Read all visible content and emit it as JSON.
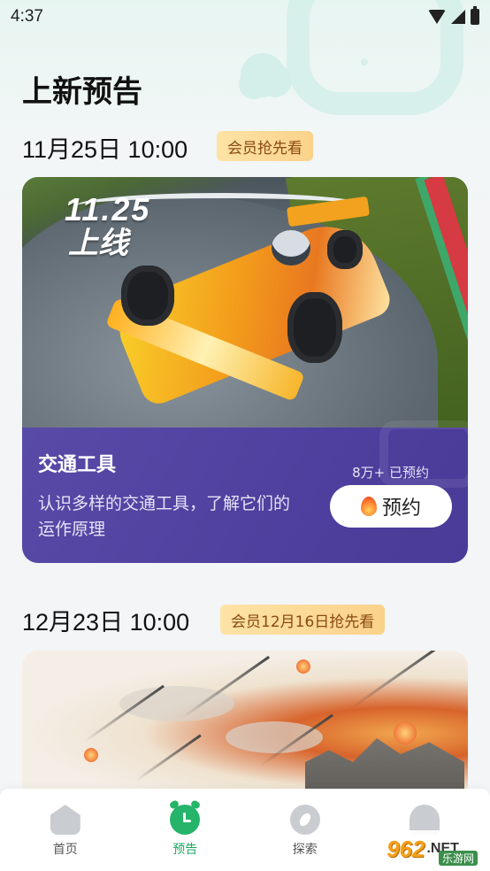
{
  "status_bar": {
    "time": "4:37"
  },
  "page": {
    "title": "上新预告"
  },
  "sections": [
    {
      "date": "11月25日 10:00",
      "member_tag": "会员抢先看",
      "card": {
        "image_text": {
          "date": "11.25",
          "sub": "上线"
        },
        "title": "交通工具",
        "description": "认识多样的交通工具，了解它们的运作原理",
        "reserve_count": "8万+ 已预约",
        "reserve_button": "预约"
      }
    },
    {
      "date": "12月23日 10:00",
      "member_tag": "会员12月16日抢先看"
    }
  ],
  "tab_bar": {
    "items": [
      {
        "label": "首页",
        "icon": "home-icon",
        "active": false
      },
      {
        "label": "预告",
        "icon": "alarm-clock-icon",
        "active": true
      },
      {
        "label": "探索",
        "icon": "compass-icon",
        "active": false
      },
      {
        "label": "",
        "icon": "profile-icon",
        "active": false
      }
    ]
  },
  "watermark": {
    "number": "962",
    "suffix": ".NET",
    "sub": "乐游网"
  },
  "colors": {
    "accent_green": "#1ca862",
    "card_purple": "#5a4aa8",
    "tag_gold": "#fbd28a"
  }
}
